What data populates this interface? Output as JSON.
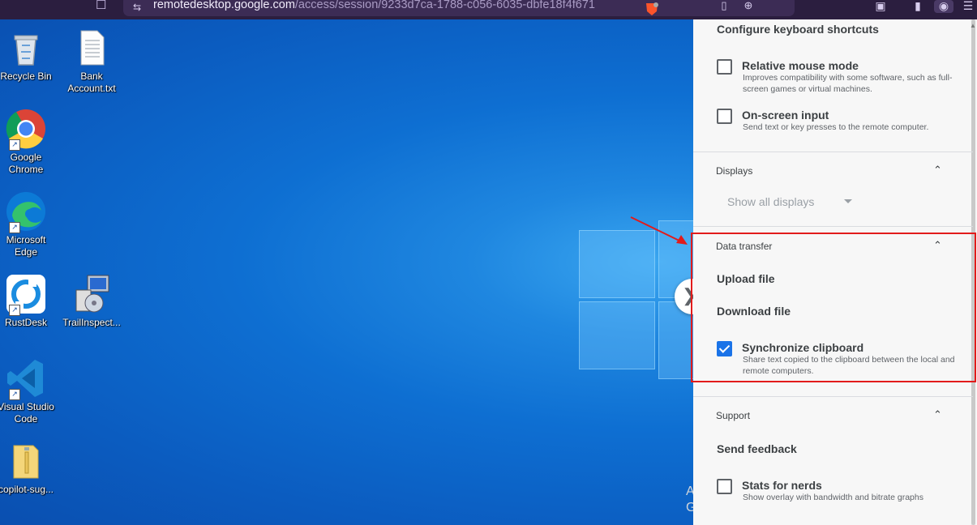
{
  "browser": {
    "url_host": "remotedesktop.google.com",
    "url_path": "/access/session/9233d7ca-1788-c056-6035-dbfe18f4f671"
  },
  "desktop": {
    "icons": [
      {
        "label": "Recycle Bin",
        "icon": "recycle-bin-icon"
      },
      {
        "label": "Bank Account.txt",
        "icon": "text-file-icon"
      },
      {
        "label": "Google Chrome",
        "icon": "chrome-icon"
      },
      {
        "label": "Microsoft Edge",
        "icon": "edge-icon"
      },
      {
        "label": "RustDesk",
        "icon": "rustdesk-icon"
      },
      {
        "label": "TrailInspect...",
        "icon": "installer-icon"
      },
      {
        "label": "Visual Studio Code",
        "icon": "vscode-icon"
      },
      {
        "label": "copilot-sug...",
        "icon": "folder-icon"
      }
    ]
  },
  "panel": {
    "configure_shortcuts": "Configure keyboard shortcuts",
    "relative_mouse": {
      "title": "Relative mouse mode",
      "desc": "Improves compatibility with some software, such as full-screen games or virtual machines.",
      "checked": false
    },
    "onscreen_input": {
      "title": "On-screen input",
      "desc": "Send text or key presses to the remote computer.",
      "checked": false
    },
    "displays": {
      "header": "Displays",
      "select_value": "Show all displays"
    },
    "data_transfer": {
      "header": "Data transfer",
      "upload": "Upload file",
      "download": "Download file",
      "sync_clipboard": {
        "title": "Synchronize clipboard",
        "desc": "Share text copied to the clipboard between the local and remote computers.",
        "checked": true
      }
    },
    "support": {
      "header": "Support",
      "send_feedback": "Send feedback",
      "stats": {
        "title": "Stats for nerds",
        "desc": "Show overlay with bandwidth and bitrate graphs",
        "checked": false
      }
    }
  },
  "colors": {
    "accent": "#1a73e8",
    "highlight": "#e21b1b",
    "browser_bar": "#2b1e3f"
  }
}
